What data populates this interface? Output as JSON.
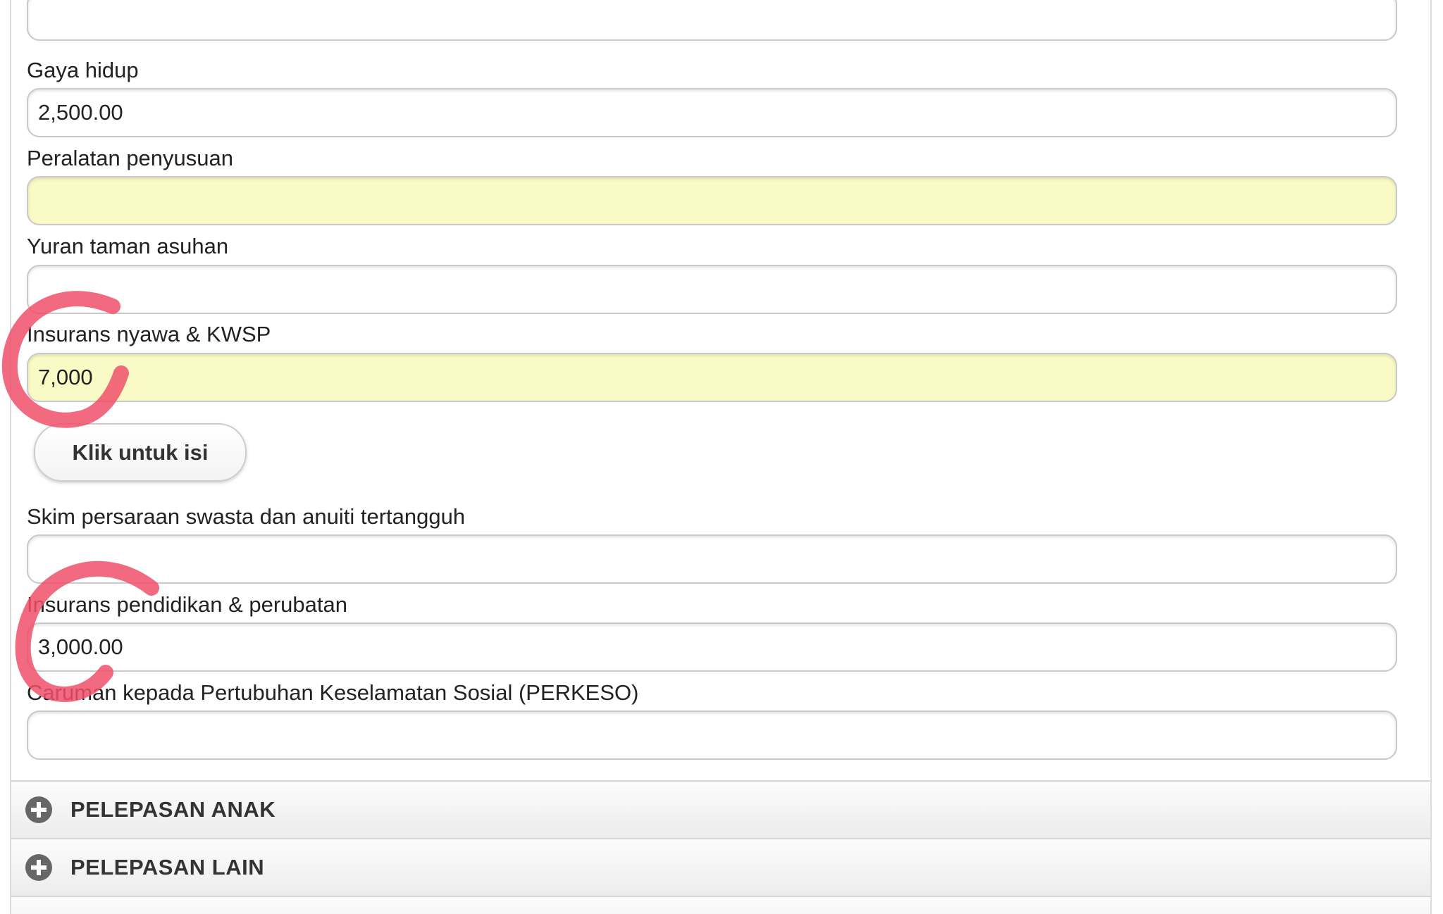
{
  "form": {
    "fields": [
      {
        "label": "",
        "value": ""
      },
      {
        "label": "Gaya hidup",
        "value": "2,500.00"
      },
      {
        "label": "Peralatan penyusuan",
        "value": ""
      },
      {
        "label": "Yuran taman asuhan",
        "value": ""
      },
      {
        "label": "Insurans nyawa & KWSP",
        "value": "7,000"
      },
      {
        "label": "Skim persaraan swasta dan anuiti tertangguh",
        "value": ""
      },
      {
        "label": "Insurans pendidikan & perubatan",
        "value": "3,000.00"
      },
      {
        "label": "Caruman kepada Pertubuhan Keselamatan Sosial (PERKESO)",
        "value": ""
      }
    ],
    "fill_button_label": "Klik untuk isi"
  },
  "sections": [
    {
      "title": "PELEPASAN ANAK",
      "icon": "plus-circle-icon"
    },
    {
      "title": "PELEPASAN LAIN",
      "icon": "plus-circle-icon"
    }
  ],
  "colors": {
    "highlight_field": "#fafac6",
    "annotation": "#ee5068"
  }
}
